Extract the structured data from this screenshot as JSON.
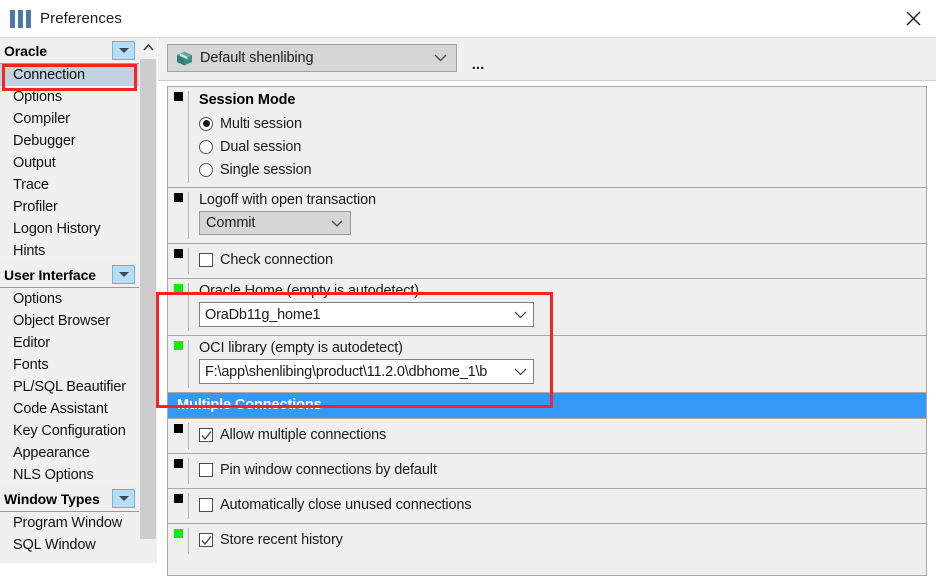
{
  "window": {
    "title": "Preferences",
    "title_icon": "sliders-icon",
    "close_icon": "close-icon"
  },
  "colors": {
    "accent_blue": "#3399f7",
    "selection_blue": "#c3d2e0",
    "annotation_red": "#fb2222",
    "modified_marker_green": "#15e817",
    "marker_black": "#000000",
    "group_button_blue": "#b8dcf4",
    "package_icon_teal": "#3f8f86"
  },
  "sidebar": {
    "groups": [
      {
        "label": "Oracle",
        "expander_icon": "chevron-down-icon",
        "items": [
          {
            "label": "Connection",
            "selected": true
          },
          {
            "label": "Options",
            "selected": false
          },
          {
            "label": "Compiler",
            "selected": false
          },
          {
            "label": "Debugger",
            "selected": false
          },
          {
            "label": "Output",
            "selected": false
          },
          {
            "label": "Trace",
            "selected": false
          },
          {
            "label": "Profiler",
            "selected": false
          },
          {
            "label": "Logon History",
            "selected": false
          },
          {
            "label": "Hints",
            "selected": false
          }
        ]
      },
      {
        "label": "User Interface",
        "expander_icon": "chevron-down-icon",
        "items": [
          {
            "label": "Options",
            "selected": false
          },
          {
            "label": "Object Browser",
            "selected": false
          },
          {
            "label": "Editor",
            "selected": false
          },
          {
            "label": "Fonts",
            "selected": false
          },
          {
            "label": "PL/SQL Beautifier",
            "selected": false
          },
          {
            "label": "Code Assistant",
            "selected": false
          },
          {
            "label": "Key Configuration",
            "selected": false
          },
          {
            "label": "Appearance",
            "selected": false
          },
          {
            "label": "NLS Options",
            "selected": false
          }
        ]
      },
      {
        "label": "Window Types",
        "expander_icon": "chevron-down-icon",
        "items": [
          {
            "label": "Program Window",
            "selected": false
          },
          {
            "label": "SQL Window",
            "selected": false
          }
        ]
      }
    ],
    "scrollbar": {
      "up_arrow_icon": "chevron-up-icon"
    }
  },
  "profile_bar": {
    "icon": "package-icon",
    "value": "Default shenlibing",
    "chevron_icon": "chevron-down-icon",
    "more_button_label": "..."
  },
  "settings": {
    "session_mode": {
      "marker": "black",
      "title": "Session Mode",
      "options": [
        {
          "label": "Multi session",
          "checked": true
        },
        {
          "label": "Dual session",
          "checked": false
        },
        {
          "label": "Single session",
          "checked": false
        }
      ]
    },
    "logoff": {
      "marker": "black",
      "label": "Logoff with open transaction",
      "value": "Commit",
      "chevron_icon": "chevron-down-icon"
    },
    "check_connection": {
      "marker": "black",
      "label": "Check connection",
      "checked": false
    },
    "oracle_home": {
      "marker": "green",
      "label": "Oracle Home (empty is autodetect)",
      "value": "OraDb11g_home1",
      "chevron_icon": "chevron-down-icon"
    },
    "oci_library": {
      "marker": "green",
      "label": "OCI library (empty is autodetect)",
      "value": "F:\\app\\shenlibing\\product\\11.2.0\\dbhome_1\\b",
      "chevron_icon": "chevron-down-icon"
    },
    "multiple_connections_header": "Multiple Connections",
    "multiple_connections": [
      {
        "marker": "black",
        "label": "Allow multiple connections",
        "checked": true
      },
      {
        "marker": "black",
        "label": "Pin window connections by default",
        "checked": false
      },
      {
        "marker": "black",
        "label": "Automatically close unused connections",
        "checked": false
      },
      {
        "marker": "green",
        "label": "Store recent history",
        "checked": true
      }
    ]
  },
  "annotations": [
    {
      "name": "connection-highlight",
      "target": "sidebar-item-connection"
    },
    {
      "name": "oracle-home-oci-highlight",
      "target": "oracle-home-and-oci-rows"
    }
  ]
}
